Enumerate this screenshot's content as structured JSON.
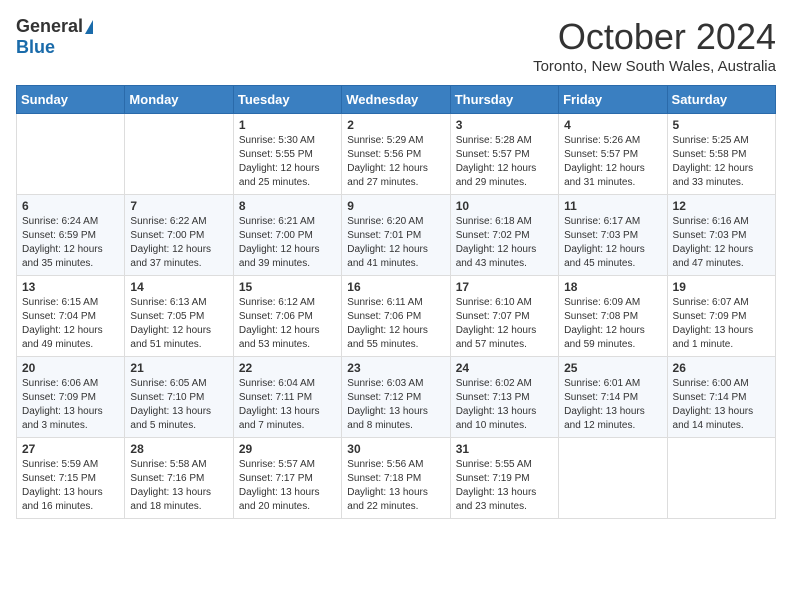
{
  "logo": {
    "general": "General",
    "blue": "Blue"
  },
  "title": {
    "month_year": "October 2024",
    "location": "Toronto, New South Wales, Australia"
  },
  "headers": [
    "Sunday",
    "Monday",
    "Tuesday",
    "Wednesday",
    "Thursday",
    "Friday",
    "Saturday"
  ],
  "weeks": [
    [
      {
        "day": "",
        "info": ""
      },
      {
        "day": "",
        "info": ""
      },
      {
        "day": "1",
        "info": "Sunrise: 5:30 AM\nSunset: 5:55 PM\nDaylight: 12 hours\nand 25 minutes."
      },
      {
        "day": "2",
        "info": "Sunrise: 5:29 AM\nSunset: 5:56 PM\nDaylight: 12 hours\nand 27 minutes."
      },
      {
        "day": "3",
        "info": "Sunrise: 5:28 AM\nSunset: 5:57 PM\nDaylight: 12 hours\nand 29 minutes."
      },
      {
        "day": "4",
        "info": "Sunrise: 5:26 AM\nSunset: 5:57 PM\nDaylight: 12 hours\nand 31 minutes."
      },
      {
        "day": "5",
        "info": "Sunrise: 5:25 AM\nSunset: 5:58 PM\nDaylight: 12 hours\nand 33 minutes."
      }
    ],
    [
      {
        "day": "6",
        "info": "Sunrise: 6:24 AM\nSunset: 6:59 PM\nDaylight: 12 hours\nand 35 minutes."
      },
      {
        "day": "7",
        "info": "Sunrise: 6:22 AM\nSunset: 7:00 PM\nDaylight: 12 hours\nand 37 minutes."
      },
      {
        "day": "8",
        "info": "Sunrise: 6:21 AM\nSunset: 7:00 PM\nDaylight: 12 hours\nand 39 minutes."
      },
      {
        "day": "9",
        "info": "Sunrise: 6:20 AM\nSunset: 7:01 PM\nDaylight: 12 hours\nand 41 minutes."
      },
      {
        "day": "10",
        "info": "Sunrise: 6:18 AM\nSunset: 7:02 PM\nDaylight: 12 hours\nand 43 minutes."
      },
      {
        "day": "11",
        "info": "Sunrise: 6:17 AM\nSunset: 7:03 PM\nDaylight: 12 hours\nand 45 minutes."
      },
      {
        "day": "12",
        "info": "Sunrise: 6:16 AM\nSunset: 7:03 PM\nDaylight: 12 hours\nand 47 minutes."
      }
    ],
    [
      {
        "day": "13",
        "info": "Sunrise: 6:15 AM\nSunset: 7:04 PM\nDaylight: 12 hours\nand 49 minutes."
      },
      {
        "day": "14",
        "info": "Sunrise: 6:13 AM\nSunset: 7:05 PM\nDaylight: 12 hours\nand 51 minutes."
      },
      {
        "day": "15",
        "info": "Sunrise: 6:12 AM\nSunset: 7:06 PM\nDaylight: 12 hours\nand 53 minutes."
      },
      {
        "day": "16",
        "info": "Sunrise: 6:11 AM\nSunset: 7:06 PM\nDaylight: 12 hours\nand 55 minutes."
      },
      {
        "day": "17",
        "info": "Sunrise: 6:10 AM\nSunset: 7:07 PM\nDaylight: 12 hours\nand 57 minutes."
      },
      {
        "day": "18",
        "info": "Sunrise: 6:09 AM\nSunset: 7:08 PM\nDaylight: 12 hours\nand 59 minutes."
      },
      {
        "day": "19",
        "info": "Sunrise: 6:07 AM\nSunset: 7:09 PM\nDaylight: 13 hours\nand 1 minute."
      }
    ],
    [
      {
        "day": "20",
        "info": "Sunrise: 6:06 AM\nSunset: 7:09 PM\nDaylight: 13 hours\nand 3 minutes."
      },
      {
        "day": "21",
        "info": "Sunrise: 6:05 AM\nSunset: 7:10 PM\nDaylight: 13 hours\nand 5 minutes."
      },
      {
        "day": "22",
        "info": "Sunrise: 6:04 AM\nSunset: 7:11 PM\nDaylight: 13 hours\nand 7 minutes."
      },
      {
        "day": "23",
        "info": "Sunrise: 6:03 AM\nSunset: 7:12 PM\nDaylight: 13 hours\nand 8 minutes."
      },
      {
        "day": "24",
        "info": "Sunrise: 6:02 AM\nSunset: 7:13 PM\nDaylight: 13 hours\nand 10 minutes."
      },
      {
        "day": "25",
        "info": "Sunrise: 6:01 AM\nSunset: 7:14 PM\nDaylight: 13 hours\nand 12 minutes."
      },
      {
        "day": "26",
        "info": "Sunrise: 6:00 AM\nSunset: 7:14 PM\nDaylight: 13 hours\nand 14 minutes."
      }
    ],
    [
      {
        "day": "27",
        "info": "Sunrise: 5:59 AM\nSunset: 7:15 PM\nDaylight: 13 hours\nand 16 minutes."
      },
      {
        "day": "28",
        "info": "Sunrise: 5:58 AM\nSunset: 7:16 PM\nDaylight: 13 hours\nand 18 minutes."
      },
      {
        "day": "29",
        "info": "Sunrise: 5:57 AM\nSunset: 7:17 PM\nDaylight: 13 hours\nand 20 minutes."
      },
      {
        "day": "30",
        "info": "Sunrise: 5:56 AM\nSunset: 7:18 PM\nDaylight: 13 hours\nand 22 minutes."
      },
      {
        "day": "31",
        "info": "Sunrise: 5:55 AM\nSunset: 7:19 PM\nDaylight: 13 hours\nand 23 minutes."
      },
      {
        "day": "",
        "info": ""
      },
      {
        "day": "",
        "info": ""
      }
    ]
  ]
}
